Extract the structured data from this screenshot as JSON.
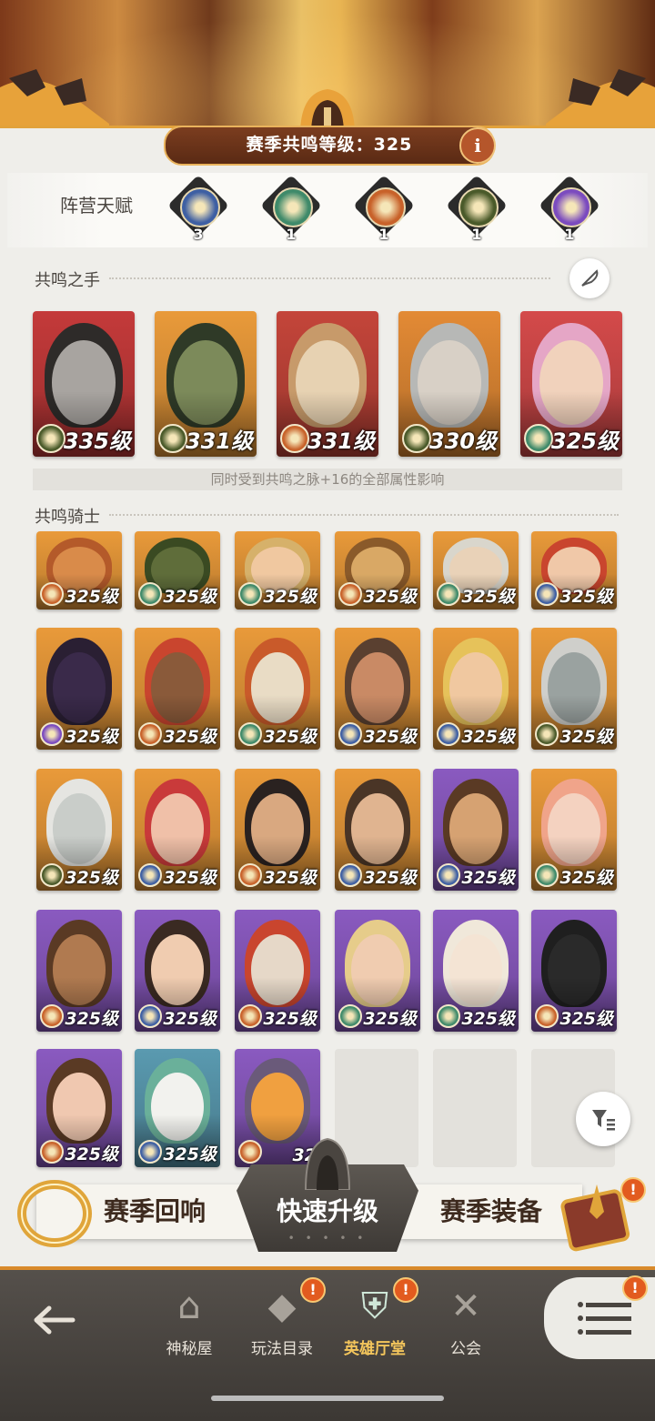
{
  "header": {
    "season_level_label": "赛季共鸣等级：325",
    "info_icon": "i"
  },
  "faction": {
    "label": "阵营天赋",
    "items": [
      {
        "icon": "lightbearer-icon",
        "count": "3",
        "color": "#3e5fa3"
      },
      {
        "icon": "wilder-icon",
        "count": "1",
        "color": "#3f8a6a"
      },
      {
        "icon": "mauler-icon",
        "count": "1",
        "color": "#c8622a"
      },
      {
        "icon": "graveborn-icon",
        "count": "1",
        "color": "#4a5a2a"
      },
      {
        "icon": "celestial-icon",
        "count": "1",
        "color": "#7b4bbf"
      }
    ]
  },
  "resonance_hands": {
    "title": "共鸣之手",
    "note": "同时受到共鸣之脉+16的全部属性影响",
    "cards": [
      {
        "level": "335级",
        "bg": "#c43a3a",
        "faction_color": "#4a5a2a",
        "face": "#a8a4a0",
        "hair": "#2e2b29"
      },
      {
        "level": "331级",
        "bg": "#e99a3a",
        "faction_color": "#4a5a2a",
        "face": "#7c8a5a",
        "hair": "#2f3a27"
      },
      {
        "level": "331级",
        "bg": "#c4453a",
        "faction_color": "#c8622a",
        "face": "#e7d2b2",
        "hair": "#c79a6a"
      },
      {
        "level": "330级",
        "bg": "#e38a35",
        "faction_color": "#4a5a2a",
        "face": "#d8d0c6",
        "hair": "#b7b8b6"
      },
      {
        "level": "325级",
        "bg": "#d44a4a",
        "faction_color": "#3f8a6a",
        "face": "#f1d2bc",
        "hair": "#e5a6c6"
      }
    ]
  },
  "resonance_knights": {
    "title": "共鸣骑士",
    "cards": [
      {
        "level": "325级",
        "bg": "#e99a3a",
        "faction_color": "#c8622a",
        "face": "#d98b4a",
        "hair": "#b45a2a"
      },
      {
        "level": "325级",
        "bg": "#e99a3a",
        "faction_color": "#3f8a6a",
        "face": "#5f6d3a",
        "hair": "#3a4a22"
      },
      {
        "level": "325级",
        "bg": "#e99a3a",
        "faction_color": "#3f8a6a",
        "face": "#f0c8a0",
        "hair": "#d6b16a"
      },
      {
        "level": "325级",
        "bg": "#e99a3a",
        "faction_color": "#c8622a",
        "face": "#d9a865",
        "hair": "#8a5a2a"
      },
      {
        "level": "325级",
        "bg": "#e99a3a",
        "faction_color": "#3f8a6a",
        "face": "#e9d2b8",
        "hair": "#d9d6cc"
      },
      {
        "level": "325级",
        "bg": "#e99a3a",
        "faction_color": "#3e5fa3",
        "face": "#f0c8a8",
        "hair": "#c9452e"
      },
      {
        "level": "325级",
        "bg": "#e99a3a",
        "faction_color": "#7b4bbf",
        "face": "#3a2a4a",
        "hair": "#2a1f33"
      },
      {
        "level": "325级",
        "bg": "#e99a3a",
        "faction_color": "#c8622a",
        "face": "#8a5a3a",
        "hair": "#c9452e"
      },
      {
        "level": "325级",
        "bg": "#e99a3a",
        "faction_color": "#3f8a6a",
        "face": "#e9dcc5",
        "hair": "#c95a2a"
      },
      {
        "level": "325级",
        "bg": "#e99a3a",
        "faction_color": "#3e5fa3",
        "face": "#c98a65",
        "hair": "#5a4030"
      },
      {
        "level": "325级",
        "bg": "#e99a3a",
        "faction_color": "#3e5fa3",
        "face": "#f0c8a0",
        "hair": "#e6c25a"
      },
      {
        "level": "325级",
        "bg": "#e99a3a",
        "faction_color": "#4a5a2a",
        "face": "#9aa2a0",
        "hair": "#cfcfcb"
      },
      {
        "level": "325级",
        "bg": "#e99a3a",
        "faction_color": "#4a5a2a",
        "face": "#c9cdc9",
        "hair": "#e5e5e1"
      },
      {
        "level": "325级",
        "bg": "#e99a3a",
        "faction_color": "#3e5fa3",
        "face": "#f0c0a8",
        "hair": "#c93a3a"
      },
      {
        "level": "325级",
        "bg": "#e99a3a",
        "faction_color": "#c8622a",
        "face": "#d9a880",
        "hair": "#2a2220"
      },
      {
        "level": "325级",
        "bg": "#e99a3a",
        "faction_color": "#3e5fa3",
        "face": "#e0b490",
        "hair": "#4a3526"
      },
      {
        "level": "325级",
        "bg": "#8a5ac0",
        "faction_color": "#3e5fa3",
        "face": "#d6a272",
        "hair": "#5a3a24"
      },
      {
        "level": "325级",
        "bg": "#e99a3a",
        "faction_color": "#3f8a6a",
        "face": "#f4d2c0",
        "hair": "#f0a48a"
      },
      {
        "level": "325级",
        "bg": "#8a5ac0",
        "faction_color": "#c8622a",
        "face": "#b07a50",
        "hair": "#5a3a24"
      },
      {
        "level": "325级",
        "bg": "#8a5ac0",
        "faction_color": "#3e5fa3",
        "face": "#f0ccb0",
        "hair": "#3a2a22"
      },
      {
        "level": "325级",
        "bg": "#8a5ac0",
        "faction_color": "#c8622a",
        "face": "#e6d8c8",
        "hair": "#c9452e"
      },
      {
        "level": "325级",
        "bg": "#8a5ac0",
        "faction_color": "#3f8a6a",
        "face": "#f0ccb0",
        "hair": "#e6cc8a"
      },
      {
        "level": "325级",
        "bg": "#8a5ac0",
        "faction_color": "#3f8a6a",
        "face": "#f4e4d4",
        "hair": "#f0e8da"
      },
      {
        "level": "325级",
        "bg": "#8a5ac0",
        "faction_color": "#c8622a",
        "face": "#2a2a2a",
        "hair": "#1f1f1f"
      },
      {
        "level": "325级",
        "bg": "#8a5ac0",
        "faction_color": "#c8622a",
        "face": "#f0c8b0",
        "hair": "#5a3a24"
      },
      {
        "level": "325级",
        "bg": "#5a9ab0",
        "faction_color": "#3e5fa3",
        "face": "#f2f2ee",
        "hair": "#6ab09a"
      },
      {
        "level": "32",
        "bg": "#8a5ac0",
        "faction_color": "#c8622a",
        "face": "#f0a040",
        "hair": "#6a5a7a"
      }
    ]
  },
  "actions": {
    "left": "赛季回响",
    "middle": "快速升级",
    "right": "赛季装备",
    "right_badge": "!",
    "left_icon": "ring-icon",
    "right_icon": "treasure-icon"
  },
  "nav": {
    "items": [
      {
        "label": "神秘屋",
        "icon": "mystery-hut-icon",
        "badge": ""
      },
      {
        "label": "玩法目录",
        "icon": "game-modes-icon",
        "badge": "!"
      },
      {
        "label": "英雄厅堂",
        "icon": "hero-hall-icon",
        "badge": "!"
      },
      {
        "label": "公会",
        "icon": "guild-icon",
        "badge": ""
      }
    ],
    "menu_badge": "!"
  }
}
